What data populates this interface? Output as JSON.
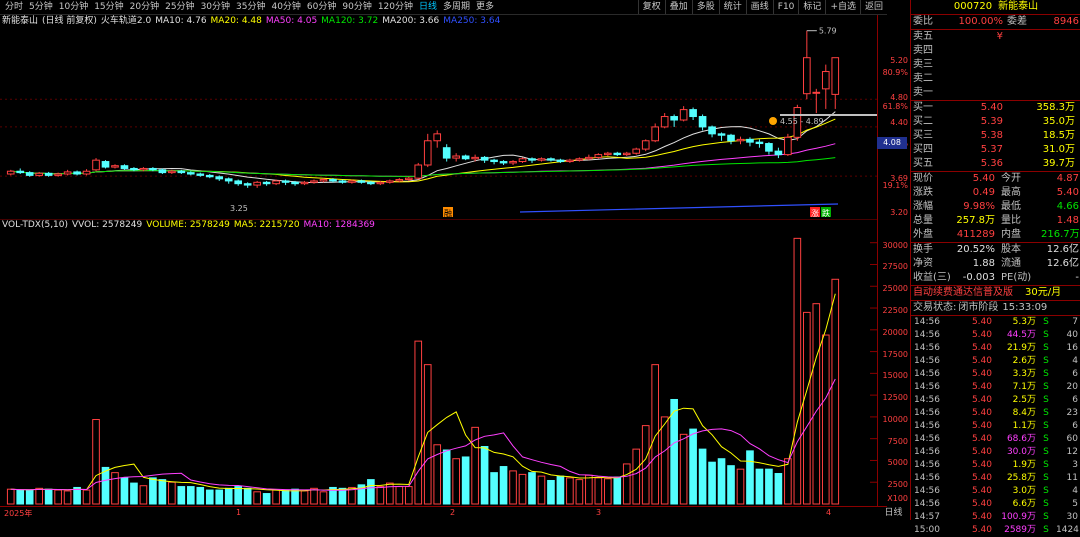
{
  "toolbar": {
    "periods": [
      "分时",
      "5分钟",
      "10分钟",
      "15分钟",
      "20分钟",
      "25分钟",
      "30分钟",
      "35分钟",
      "40分钟",
      "60分钟",
      "90分钟",
      "120分钟",
      "日线",
      "多周期",
      "更多"
    ],
    "active_period": "日线",
    "right_buttons": [
      "复权",
      "叠加",
      "多股",
      "统计",
      "画线",
      "F10",
      "标记",
      "+自选",
      "返回"
    ]
  },
  "main_legend": {
    "name": "新能泰山",
    "mode": "(日线 前复权)",
    "indicator": "火车轨道2.0",
    "ma10": "MA10: 4.76",
    "ma20": "MA20: 4.48",
    "ma50": "MA50: 4.05",
    "ma120": "MA120: 3.72",
    "ma200": "MA200: 3.66",
    "ma250": "MA250: 3.64"
  },
  "vol_legend": {
    "name": "VOL-TDX(5,10)",
    "vvol": "VVOL: 2578249",
    "volume": "VOLUME: 2578249",
    "ma5": "MA5: 2215720",
    "ma10": "MA10: 1284369"
  },
  "price_axis": [
    "5.20",
    "80.9%",
    "4.80",
    "61.8%",
    "4.40",
    "50.0%",
    "3.69",
    "19.1%",
    "3.20"
  ],
  "vol_axis": [
    "30000",
    "27500",
    "25000",
    "22500",
    "20000",
    "17500",
    "15000",
    "12500",
    "10000",
    "7500",
    "5000",
    "2500"
  ],
  "vol_unit": "X100",
  "annotations": {
    "high": "5.79",
    "low": "3.25",
    "range": "4.55 - 4.89",
    "tag1": "融",
    "tag2": "涨",
    "tag3": "跌"
  },
  "current_tag": "4.08",
  "date_axis": {
    "year": "2025年",
    "m1": "1",
    "m2": "2",
    "m3": "3",
    "m4": "4"
  },
  "side_button": "日线",
  "panel": {
    "code": "000720",
    "name": "新能泰山",
    "weibi_label": "委比",
    "weibi": "100.00%",
    "weicha_label": "委差",
    "weicha": "8946",
    "sells": [
      {
        "label": "卖五",
        "price": "¥",
        "vol": ""
      },
      {
        "label": "卖四",
        "price": "",
        "vol": ""
      },
      {
        "label": "卖三",
        "price": "",
        "vol": ""
      },
      {
        "label": "卖二",
        "price": "",
        "vol": ""
      },
      {
        "label": "卖一",
        "price": "",
        "vol": ""
      }
    ],
    "buys": [
      {
        "label": "买一",
        "price": "5.40",
        "vol": "358.3万"
      },
      {
        "label": "买二",
        "price": "5.39",
        "vol": "35.0万"
      },
      {
        "label": "买三",
        "price": "5.38",
        "vol": "18.5万"
      },
      {
        "label": "买四",
        "price": "5.37",
        "vol": "31.0万"
      },
      {
        "label": "买五",
        "price": "5.36",
        "vol": "39.7万"
      }
    ],
    "stats": [
      {
        "l1": "现价",
        "v1": "5.40",
        "c1": "red",
        "l2": "今开",
        "v2": "4.87",
        "c2": "red"
      },
      {
        "l1": "涨跌",
        "v1": "0.49",
        "c1": "red",
        "l2": "最高",
        "v2": "5.40",
        "c2": "red"
      },
      {
        "l1": "涨幅",
        "v1": "9.98%",
        "c1": "red",
        "l2": "最低",
        "v2": "4.66",
        "c2": "green"
      },
      {
        "l1": "总量",
        "v1": "257.8万",
        "c1": "yellow",
        "l2": "量比",
        "v2": "1.48",
        "c2": "red"
      },
      {
        "l1": "外盘",
        "v1": "411289",
        "c1": "red",
        "l2": "内盘",
        "v2": "216.7万",
        "c2": "green"
      }
    ],
    "stats2": [
      {
        "l1": "换手",
        "v1": "20.52%",
        "l2": "股本",
        "v2": "12.6亿"
      },
      {
        "l1": "净资",
        "v1": "1.88",
        "l2": "流通",
        "v2": "12.6亿"
      },
      {
        "l1": "收益(三)",
        "v1": "-0.003",
        "l2": "PE(动)",
        "v2": "-"
      }
    ],
    "promo": "自动续费通达信普及版",
    "promo_price": "30元/月",
    "status_label": "交易状态:",
    "status": "闭市阶段",
    "status_time": "15:33:09",
    "ticks": [
      {
        "t": "14:56",
        "p": "5.40",
        "v": "5.3万",
        "c": "yellow",
        "bs": "S",
        "n": "7"
      },
      {
        "t": "14:56",
        "p": "5.40",
        "v": "44.5万",
        "c": "magenta",
        "bs": "S",
        "n": "40"
      },
      {
        "t": "14:56",
        "p": "5.40",
        "v": "21.9万",
        "c": "yellow",
        "bs": "S",
        "n": "16"
      },
      {
        "t": "14:56",
        "p": "5.40",
        "v": "2.6万",
        "c": "yellow",
        "bs": "S",
        "n": "4"
      },
      {
        "t": "14:56",
        "p": "5.40",
        "v": "3.3万",
        "c": "yellow",
        "bs": "S",
        "n": "6"
      },
      {
        "t": "14:56",
        "p": "5.40",
        "v": "7.1万",
        "c": "yellow",
        "bs": "S",
        "n": "20"
      },
      {
        "t": "14:56",
        "p": "5.40",
        "v": "2.5万",
        "c": "yellow",
        "bs": "S",
        "n": "6"
      },
      {
        "t": "14:56",
        "p": "5.40",
        "v": "8.4万",
        "c": "yellow",
        "bs": "S",
        "n": "23"
      },
      {
        "t": "14:56",
        "p": "5.40",
        "v": "1.1万",
        "c": "yellow",
        "bs": "S",
        "n": "6"
      },
      {
        "t": "14:56",
        "p": "5.40",
        "v": "68.6万",
        "c": "magenta",
        "bs": "S",
        "n": "60"
      },
      {
        "t": "14:56",
        "p": "5.40",
        "v": "30.0万",
        "c": "magenta",
        "bs": "S",
        "n": "12"
      },
      {
        "t": "14:56",
        "p": "5.40",
        "v": "1.9万",
        "c": "yellow",
        "bs": "S",
        "n": "3"
      },
      {
        "t": "14:56",
        "p": "5.40",
        "v": "25.8万",
        "c": "yellow",
        "bs": "S",
        "n": "11"
      },
      {
        "t": "14:56",
        "p": "5.40",
        "v": "3.0万",
        "c": "yellow",
        "bs": "S",
        "n": "4"
      },
      {
        "t": "14:56",
        "p": "5.40",
        "v": "6.6万",
        "c": "yellow",
        "bs": "S",
        "n": "5"
      },
      {
        "t": "14:57",
        "p": "5.40",
        "v": "100.9万",
        "c": "magenta",
        "bs": "S",
        "n": "30"
      },
      {
        "t": "15:00",
        "p": "5.40",
        "v": "2589万",
        "c": "magenta",
        "bs": "S",
        "n": "1424"
      }
    ]
  },
  "colors": {
    "up": "#ff4040",
    "down": "#54ffff",
    "bg": "#000000",
    "ma10": "#e0e0e0",
    "ma20": "#ffff00",
    "ma50": "#ff40ff",
    "ma120": "#00e600",
    "ma250": "#3050ff"
  },
  "chart_data": {
    "type": "candlestick",
    "price_range": [
      3.2,
      5.8
    ],
    "candles": [
      [
        3.72,
        3.76,
        3.78,
        3.7
      ],
      [
        3.76,
        3.74,
        3.8,
        3.72
      ],
      [
        3.74,
        3.7,
        3.76,
        3.68
      ],
      [
        3.7,
        3.73,
        3.75,
        3.68
      ],
      [
        3.73,
        3.7,
        3.75,
        3.68
      ],
      [
        3.7,
        3.72,
        3.74,
        3.68
      ],
      [
        3.72,
        3.75,
        3.78,
        3.7
      ],
      [
        3.75,
        3.72,
        3.77,
        3.7
      ],
      [
        3.72,
        3.76,
        3.79,
        3.7
      ],
      [
        3.78,
        3.92,
        3.95,
        3.76
      ],
      [
        3.9,
        3.82,
        3.92,
        3.8
      ],
      [
        3.82,
        3.84,
        3.86,
        3.8
      ],
      [
        3.84,
        3.8,
        3.86,
        3.78
      ],
      [
        3.8,
        3.78,
        3.82,
        3.76
      ],
      [
        3.78,
        3.8,
        3.82,
        3.76
      ],
      [
        3.8,
        3.78,
        3.82,
        3.76
      ],
      [
        3.78,
        3.74,
        3.8,
        3.72
      ],
      [
        3.74,
        3.76,
        3.78,
        3.72
      ],
      [
        3.76,
        3.74,
        3.78,
        3.72
      ],
      [
        3.74,
        3.72,
        3.76,
        3.7
      ],
      [
        3.72,
        3.7,
        3.74,
        3.68
      ],
      [
        3.7,
        3.68,
        3.72,
        3.66
      ],
      [
        3.68,
        3.65,
        3.7,
        3.62
      ],
      [
        3.65,
        3.62,
        3.67,
        3.58
      ],
      [
        3.62,
        3.58,
        3.64,
        3.55
      ],
      [
        3.58,
        3.56,
        3.6,
        3.52
      ],
      [
        3.56,
        3.6,
        3.62,
        3.52
      ],
      [
        3.6,
        3.58,
        3.62,
        3.55
      ],
      [
        3.58,
        3.62,
        3.64,
        3.56
      ],
      [
        3.62,
        3.6,
        3.64,
        3.56
      ],
      [
        3.6,
        3.58,
        3.62,
        3.55
      ],
      [
        3.58,
        3.6,
        3.62,
        3.56
      ],
      [
        3.6,
        3.62,
        3.64,
        3.58
      ],
      [
        3.62,
        3.64,
        3.66,
        3.6
      ],
      [
        3.64,
        3.62,
        3.66,
        3.6
      ],
      [
        3.62,
        3.6,
        3.64,
        3.58
      ],
      [
        3.6,
        3.62,
        3.64,
        3.58
      ],
      [
        3.62,
        3.6,
        3.64,
        3.58
      ],
      [
        3.6,
        3.58,
        3.62,
        3.56
      ],
      [
        3.58,
        3.6,
        3.62,
        3.56
      ],
      [
        3.6,
        3.62,
        3.64,
        3.58
      ],
      [
        3.62,
        3.64,
        3.66,
        3.6
      ],
      [
        3.64,
        3.66,
        3.68,
        3.62
      ],
      [
        3.66,
        3.85,
        3.88,
        3.64
      ],
      [
        3.85,
        4.2,
        4.3,
        3.82
      ],
      [
        4.2,
        4.3,
        4.35,
        4.1
      ],
      [
        4.1,
        3.95,
        4.15,
        3.9
      ],
      [
        3.95,
        3.98,
        4.02,
        3.9
      ],
      [
        3.98,
        3.94,
        4.0,
        3.92
      ],
      [
        3.94,
        3.96,
        4.0,
        3.9
      ],
      [
        3.96,
        3.92,
        3.98,
        3.88
      ],
      [
        3.92,
        3.9,
        3.94,
        3.86
      ],
      [
        3.9,
        3.88,
        3.92,
        3.85
      ],
      [
        3.88,
        3.9,
        3.92,
        3.85
      ],
      [
        3.9,
        3.94,
        3.96,
        3.88
      ],
      [
        3.94,
        3.92,
        3.96,
        3.88
      ],
      [
        3.92,
        3.94,
        3.96,
        3.9
      ],
      [
        3.94,
        3.92,
        3.96,
        3.9
      ],
      [
        3.92,
        3.9,
        3.94,
        3.88
      ],
      [
        3.9,
        3.92,
        3.94,
        3.88
      ],
      [
        3.92,
        3.94,
        3.96,
        3.9
      ],
      [
        3.94,
        3.96,
        4.0,
        3.92
      ],
      [
        3.96,
        4.0,
        4.02,
        3.94
      ],
      [
        4.0,
        4.02,
        4.04,
        3.98
      ],
      [
        4.02,
        4.0,
        4.04,
        3.98
      ],
      [
        4.0,
        4.02,
        4.04,
        3.98
      ],
      [
        4.02,
        4.08,
        4.1,
        4.0
      ],
      [
        4.08,
        4.2,
        4.22,
        4.05
      ],
      [
        4.2,
        4.4,
        4.45,
        4.18
      ],
      [
        4.4,
        4.55,
        4.6,
        4.38
      ],
      [
        4.55,
        4.5,
        4.58,
        4.4
      ],
      [
        4.5,
        4.65,
        4.7,
        4.48
      ],
      [
        4.65,
        4.55,
        4.68,
        4.5
      ],
      [
        4.55,
        4.4,
        4.58,
        4.35
      ],
      [
        4.4,
        4.3,
        4.42,
        4.25
      ],
      [
        4.3,
        4.28,
        4.32,
        4.2
      ],
      [
        4.28,
        4.2,
        4.3,
        4.15
      ],
      [
        4.2,
        4.22,
        4.26,
        4.15
      ],
      [
        4.22,
        4.18,
        4.25,
        4.12
      ],
      [
        4.18,
        4.16,
        4.22,
        4.1
      ],
      [
        4.16,
        4.05,
        4.18,
        4.0
      ],
      [
        4.05,
        4.0,
        4.1,
        3.95
      ],
      [
        4.0,
        4.25,
        4.3,
        3.98
      ],
      [
        4.25,
        4.68,
        4.72,
        4.2
      ],
      [
        4.88,
        5.4,
        5.79,
        4.8
      ],
      [
        4.9,
        4.9,
        4.95,
        4.6
      ],
      [
        4.95,
        5.2,
        5.3,
        4.66
      ],
      [
        4.87,
        5.4,
        5.4,
        4.66
      ]
    ],
    "volumes": [
      1700,
      1600,
      1600,
      1800,
      1700,
      1600,
      1500,
      1900,
      1600,
      9700,
      4200,
      3600,
      3000,
      2400,
      2100,
      3000,
      2800,
      2500,
      2000,
      2000,
      1900,
      1600,
      1600,
      1800,
      2000,
      1800,
      1400,
      1200,
      1600,
      1600,
      1700,
      1500,
      1800,
      1400,
      1900,
      1800,
      1900,
      2200,
      2800,
      2000,
      2400,
      2000,
      2000,
      18700,
      16000,
      6800,
      6200,
      5200,
      5400,
      8800,
      6600,
      3600,
      4300,
      3800,
      3400,
      3600,
      3200,
      2700,
      3200,
      3000,
      2800,
      3300,
      3000,
      2900,
      3100,
      4600,
      6300,
      9000,
      16000,
      10000,
      12000,
      8000,
      8600,
      6300,
      4800,
      5200,
      4400,
      4000,
      6100,
      4000,
      4000,
      3500,
      5200,
      30500,
      22000,
      23000,
      19400,
      25800
    ],
    "series": [
      {
        "name": "MA10"
      },
      {
        "name": "MA20"
      },
      {
        "name": "MA50"
      },
      {
        "name": "MA120"
      },
      {
        "name": "MA250"
      }
    ],
    "volume_range": [
      0,
      31000
    ]
  }
}
